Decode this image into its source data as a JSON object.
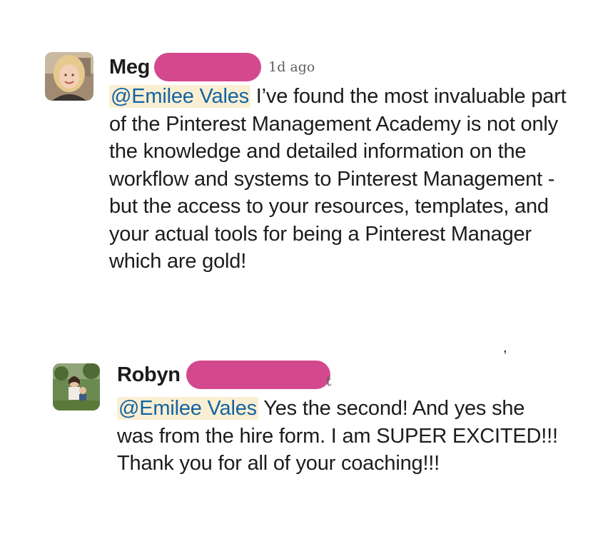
{
  "messages": [
    {
      "author": "Meg",
      "timestamp": "1d ago",
      "mention": "@Emilee Vales",
      "text": " I’ve found the most invaluable part of the Pinterest Management Academy is not only the knowledge and detailed information on the workflow and systems to Pinterest Management - but the access to your resources, templates, and your actual tools for being a Pinterest Manager which are gold!",
      "avatar_icon": "user-photo-woman"
    },
    {
      "author": "Robyn",
      "timestamp_fragment": "t",
      "mention": "@Emilee Vales",
      "text": " Yes the second!  And yes she was from the hire form.  I am SUPER EXCITED!!! Thank you for all of your coaching!!!",
      "avatar_icon": "user-photo-family"
    }
  ],
  "colors": {
    "redaction": "#d4488e",
    "mention_bg": "#fbefd3",
    "mention_text": "#1264a3"
  }
}
